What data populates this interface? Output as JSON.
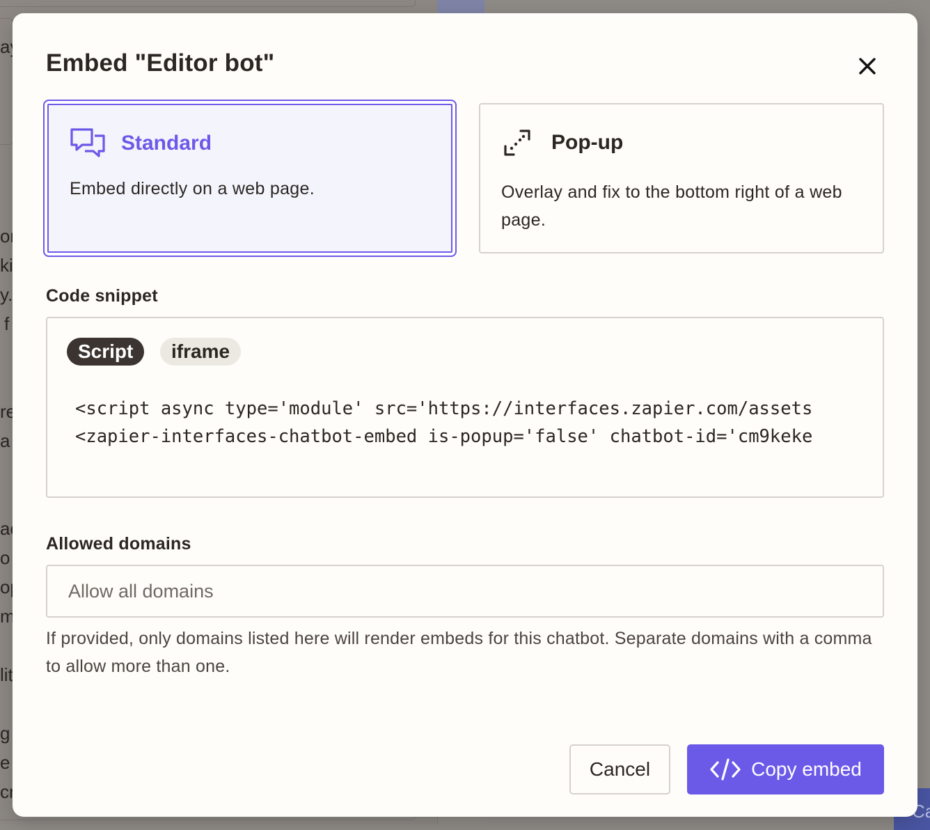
{
  "background": {
    "fragments": [
      "ay",
      "on",
      "kil",
      "y.",
      "f",
      "re",
      "a",
      "ac",
      "o t",
      "op",
      "m",
      "lit",
      "g",
      "e",
      "cr"
    ],
    "corner_button": "Ca"
  },
  "modal": {
    "title": "Embed \"Editor bot\"",
    "close_icon": "close-icon"
  },
  "embed_types": [
    {
      "key": "standard",
      "icon": "chat-bubbles-icon",
      "title": "Standard",
      "description": "Embed directly on a web page.",
      "selected": true
    },
    {
      "key": "popup",
      "icon": "popup-expand-icon",
      "title": "Pop-up",
      "description": "Overlay and fix to the bottom right of a web page.",
      "selected": false
    }
  ],
  "code_snippet": {
    "label": "Code snippet",
    "tabs": [
      {
        "label": "Script",
        "active": true
      },
      {
        "label": "iframe",
        "active": false
      }
    ],
    "lines": [
      "<script async type='module' src='https://interfaces.zapier.com/assets",
      "<zapier-interfaces-chatbot-embed is-popup='false' chatbot-id='cm9keke"
    ]
  },
  "allowed_domains": {
    "label": "Allowed domains",
    "value": "",
    "placeholder": "Allow all domains",
    "help": "If provided, only domains listed here will render embeds for this chatbot. Separate domains with a comma to allow more than one."
  },
  "actions": {
    "cancel_label": "Cancel",
    "copy_label": "Copy embed",
    "copy_icon": "code-icon"
  },
  "colors": {
    "accent": "#6b59e8",
    "text": "#2b2622",
    "border": "#d6d2cd",
    "surface": "#fffdf9"
  }
}
